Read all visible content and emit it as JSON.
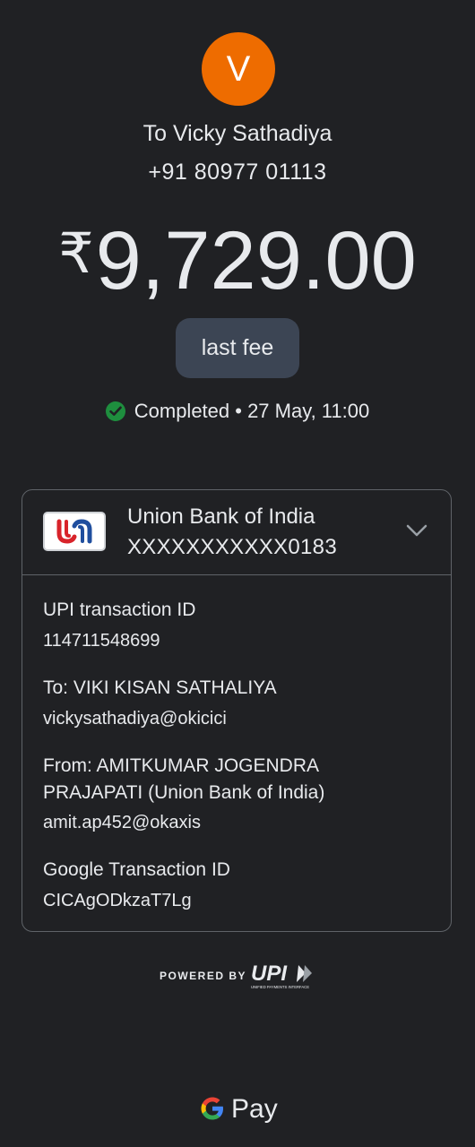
{
  "avatar": {
    "initial": "V",
    "color": "#ee6c00"
  },
  "recipient": {
    "name": "To Vicky Sathadiya",
    "phone": "+91 80977 01113"
  },
  "amount": {
    "currency": "₹",
    "value": "9,729.00"
  },
  "note": "last fee",
  "status": {
    "icon": "check-circle-icon",
    "text": "Completed • 27 May, 11:00",
    "color": "#1e8e3e"
  },
  "bank": {
    "name": "Union Bank of India",
    "account": "XXXXXXXXXXX0183",
    "expand_icon": "chevron-down-icon"
  },
  "details": {
    "upi_label": "UPI transaction ID",
    "upi_value": "114711548699",
    "to_label": "To: VIKI KISAN SATHALIYA",
    "to_value": "vickysathadiya@okicici",
    "from_label_line1": "From: AMITKUMAR JOGENDRA",
    "from_label_line2": "PRAJAPATI (Union Bank of India)",
    "from_value": "amit.ap452@okaxis",
    "google_label": "Google Transaction ID",
    "google_value": "CICAgODkzaT7Lg"
  },
  "footer": {
    "powered_by": "POWERED BY",
    "upi_logo_text": "UPI",
    "upi_subtext": "UNIFIED PAYMENTS INTERFACE",
    "brand": "Pay"
  },
  "colors": {
    "background": "#202124",
    "chip": "#3c4554",
    "border": "#5f6368",
    "text": "#e8eaed"
  }
}
